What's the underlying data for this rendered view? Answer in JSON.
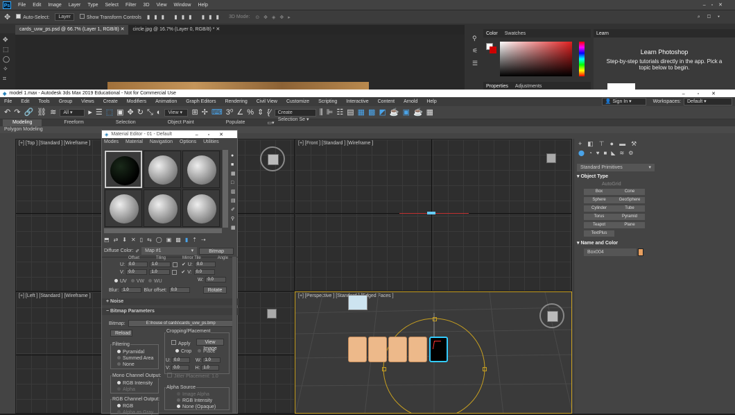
{
  "photoshop": {
    "logo": "Ps",
    "menu": [
      "File",
      "Edit",
      "Image",
      "Layer",
      "Type",
      "Select",
      "Filter",
      "3D",
      "View",
      "Window",
      "Help"
    ],
    "options": {
      "auto_select": "Auto-Select:",
      "auto_select_value": "Layer",
      "transform_controls": "Show Transform Controls",
      "mode_3d": "3D Mode:"
    },
    "tabs": [
      "cards_uvw_ps.psd @ 66.7% (Layer 1, RGB/8)",
      "circle.jpg @ 16.7% (Layer 0, RGB/8) *"
    ],
    "color_panel": {
      "tab1": "Color",
      "tab2": "Swatches",
      "tab3": "Properties",
      "tab4": "Adjustments"
    },
    "learn_panel": {
      "tab": "Learn",
      "title": "Learn Photoshop",
      "text": "Step-by-step tutorials directly in the app. Pick a topic below to begin."
    }
  },
  "max": {
    "title": "model 1.max - Autodesk 3ds Max 2019 Educational - Not for Commercial Use",
    "menu": [
      "File",
      "Edit",
      "Tools",
      "Group",
      "Views",
      "Create",
      "Modifiers",
      "Animation",
      "Graph Editors",
      "Rendering",
      "Civil View",
      "Customize",
      "Scripting",
      "Interactive",
      "Content",
      "Arnold",
      "Help"
    ],
    "sign_in": "Sign In",
    "workspaces_label": "Workspaces:",
    "workspaces_value": "Default",
    "toolbar": {
      "filter": "All",
      "view": "View",
      "selection_set": "Create Selection Se"
    },
    "ribbon": [
      "Modeling",
      "Freeform",
      "Selection",
      "Object Paint",
      "Populate"
    ],
    "subribbon": "Polygon Modeling",
    "viewports": {
      "top": "[+] [Top ] [Standard ] [Wireframe ]",
      "front": "[+] [Front ] [Standard ] [Wireframe ]",
      "left": "[+] [Left ] [Standard ] [Wireframe ]",
      "persp": "[+] [Perspective ] [Standard ] [Edged Faces ]"
    },
    "command_panel": {
      "category": "Standard Primitives",
      "object_type": "Object Type",
      "autogrid": "AutoGrid",
      "buttons": [
        "Box",
        "Cone",
        "Sphere",
        "GeoSphere",
        "Cylinder",
        "Tube",
        "Torus",
        "Pyramid",
        "Teapot",
        "Plane",
        "TextPlus"
      ],
      "name_color": "Name and Color",
      "object_name": "Box004",
      "object_color": "#e8a060"
    }
  },
  "material_editor": {
    "title": "Material Editor - 01 - Default",
    "menu": [
      "Modes",
      "Material",
      "Navigation",
      "Options",
      "Utilities"
    ],
    "diffuse_label": "Diffuse Color:",
    "map_name": "Map #1",
    "map_type": "Bitmap",
    "coords": {
      "offset": "Offset",
      "tiling": "Tiling",
      "mirror": "Mirror Tile",
      "angle": "Angle",
      "u_offset": "0.0",
      "v_offset": "0.0",
      "u_tiling": "1.0",
      "v_tiling": "1.0",
      "u_angle": "0.0",
      "v_angle": "0.0",
      "w_angle": "0.0",
      "u": "U:",
      "v": "V:",
      "w": "W:",
      "uv": "UV",
      "vw": "VW",
      "wu": "WU",
      "blur_label": "Blur:",
      "blur": "1.0",
      "blur_offset_label": "Blur offset:",
      "blur_offset": "0.0",
      "rotate": "Rotate"
    },
    "noise": "Noise",
    "bitmap_params": "Bitmap Parameters",
    "bitmap_label": "Bitmap:",
    "bitmap_path": "E:\\house of cards\\cards_uvw_ps.bmp",
    "reload": "Reload",
    "cropping": "Cropping/Placement",
    "apply": "Apply",
    "view_image": "View Image",
    "crop": "Crop",
    "place": "Place",
    "crop_u": "0.0",
    "crop_w": "1.0",
    "crop_v": "0.0",
    "crop_h": "1.0",
    "jitter": "Jitter Placement:",
    "jitter_value": "1.0",
    "filtering": "Filtering",
    "filters": [
      "Pyramidal",
      "Summed Area",
      "None"
    ],
    "mono_output": "Mono Channel Output:",
    "mono_options": [
      "RGB Intensity",
      "Alpha"
    ],
    "rgb_output": "RGB Channel Output:",
    "rgb_options": [
      "RGB",
      "Alpha as Gray"
    ],
    "alpha_source": "Alpha Source",
    "alpha_options": [
      "Image Alpha",
      "RGB Intensity",
      "None (Opaque)"
    ],
    "crop_labels": {
      "u": "U:",
      "w": "W:",
      "v": "V:",
      "h": "H:"
    }
  }
}
